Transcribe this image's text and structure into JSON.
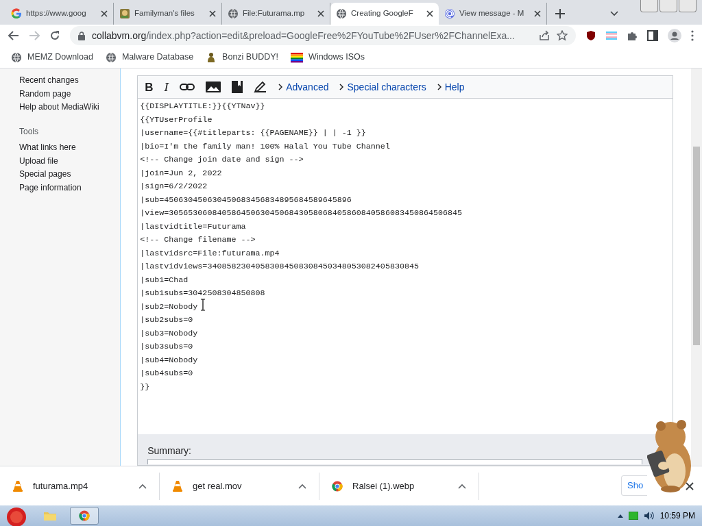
{
  "browser": {
    "tabs": [
      {
        "title": "https://www.goog",
        "selected": false
      },
      {
        "title": "Familyman's files",
        "selected": false
      },
      {
        "title": "File:Futurama.mp",
        "selected": false
      },
      {
        "title": "Creating GoogleF",
        "selected": true
      },
      {
        "title": "View message - M",
        "selected": false
      }
    ],
    "address": {
      "domain": "collabvm.org",
      "path": "/index.php?action=edit&preload=GoogleFree%2FYouTube%2FUser%2FChannelExa..."
    },
    "bookmarks": [
      {
        "title": "MEMZ Download"
      },
      {
        "title": "Malware Database"
      },
      {
        "title": "Bonzi BUDDY!"
      },
      {
        "title": "Windows ISOs"
      }
    ]
  },
  "sidebar": {
    "links": [
      "Recent changes",
      "Random page",
      "Help about MediaWiki"
    ],
    "tools_heading": "Tools",
    "tools": [
      "What links here",
      "Upload file",
      "Special pages",
      "Page information"
    ]
  },
  "editor": {
    "toolbar": {
      "bold": "B",
      "italic": "I",
      "menus": [
        "Advanced",
        "Special characters",
        "Help"
      ]
    },
    "lines": [
      "{{DISPLAYTITLE:}}{{YTNav}}",
      "{{YTUserProfile",
      "|username={{#titleparts: {{PAGENAME}} | | -1 }}",
      "|bio=I'm the family man! 100% Halal You Tube Channel",
      "<!-- Change join date and sign -->",
      "|join=Jun 2, 2022",
      "|sign=6/2/2022",
      "|sub=450630450630450683456834895684589645896",
      "|view=3056530608405864506304506843058068405860840586083450864506845",
      "|lastvidtitle=Futurama",
      "<!-- Change filename -->",
      "|lastvidsrc=File:futurama.mp4",
      "|lastvidviews=34085823040583084508308450348053082405830845",
      "|sub1=Chad",
      "|sub1subs=3042508304850808",
      "|sub2=Nobody",
      "|sub2subs=0",
      "|sub3=Nobody",
      "|sub3subs=0",
      "|sub4=Nobody",
      "|sub4subs=0",
      "}}"
    ],
    "summary_label": "Summary:"
  },
  "downloads": {
    "items": [
      {
        "name": "futurama.mp4",
        "kind": "cone"
      },
      {
        "name": "get real.mov",
        "kind": "cone"
      },
      {
        "name": "Ralsei (1).webp",
        "kind": "chrome"
      }
    ],
    "show_button": "Sho"
  },
  "taskbar": {
    "apps": [
      {
        "kind": "folder",
        "active": false
      },
      {
        "kind": "chrome",
        "active": true
      }
    ],
    "clock": "10:59 PM"
  }
}
